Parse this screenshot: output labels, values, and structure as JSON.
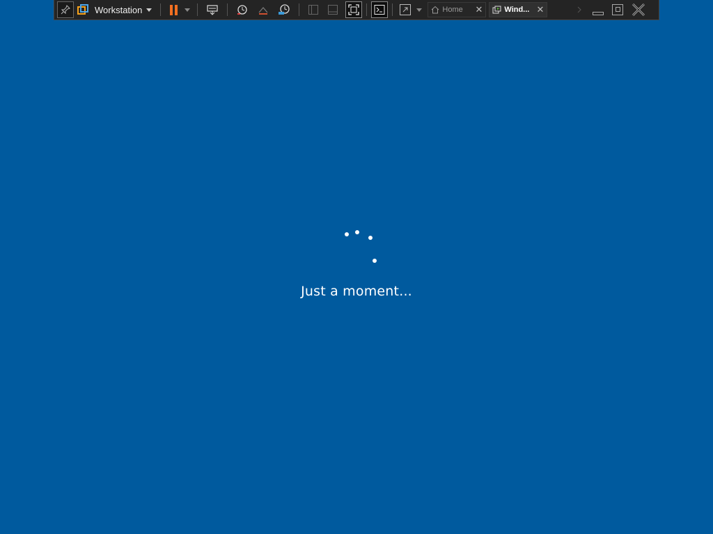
{
  "toolbar": {
    "product_label": "Workstation",
    "tabs": [
      {
        "label": "Home",
        "close": "✕"
      },
      {
        "label": "Wind...",
        "close": "✕"
      }
    ],
    "pause_color": "#f26f21"
  },
  "screen": {
    "background": "#005a9e",
    "status_text": "Just a moment..."
  }
}
